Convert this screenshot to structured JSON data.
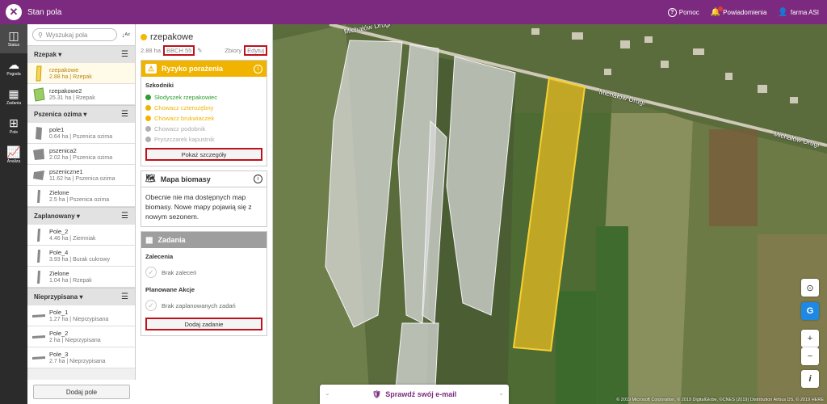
{
  "app": {
    "title": "Stan pola",
    "logo": "x-logo"
  },
  "topbar": {
    "help": "Pomoc",
    "notifications": "Powiadomienia",
    "user": "farma ASI"
  },
  "rail": [
    {
      "label": "Status",
      "icon": "status-icon"
    },
    {
      "label": "Pogoda",
      "icon": "weather-icon"
    },
    {
      "label": "Zadania",
      "icon": "tasks-icon"
    },
    {
      "label": "Pole",
      "icon": "field-icon"
    },
    {
      "label": "Analiza",
      "icon": "analysis-icon"
    }
  ],
  "search": {
    "placeholder": "Wyszukaj pola"
  },
  "groups": [
    {
      "name": "Rzepak",
      "fields": [
        {
          "name": "rzepakowe",
          "info": "2.88 ha | Rzepak"
        },
        {
          "name": "rzepakowe2",
          "info": "25.31 ha | Rzepak"
        }
      ]
    },
    {
      "name": "Pszenica ozima",
      "fields": [
        {
          "name": "pole1",
          "info": "0.64 ha | Pszenica ozima"
        },
        {
          "name": "pszenica2",
          "info": "2.02 ha | Pszenica ozima"
        },
        {
          "name": "pszeniczne1",
          "info": "11.62 ha | Pszenica ozima"
        },
        {
          "name": "Zielone",
          "info": "2.5 ha | Pszenica ozima"
        }
      ]
    },
    {
      "name": "Zaplanowany",
      "fields": [
        {
          "name": "Pole_2",
          "info": "4.46 ha | Ziemniak"
        },
        {
          "name": "Pole_4",
          "info": "3.93 ha | Burak cukrowy"
        },
        {
          "name": "Zielone",
          "info": "1.04 ha | Rzepak"
        }
      ]
    },
    {
      "name": "Nieprzypisana",
      "fields": [
        {
          "name": "Pole_1",
          "info": "1.27 ha | Nieprzypisana"
        },
        {
          "name": "Pole_2",
          "info": "2 ha | Nieprzypisana"
        },
        {
          "name": "Pole_3",
          "info": "2.7 ha | Nieprzypisana"
        }
      ]
    }
  ],
  "add_field": "Dodaj pole",
  "detail": {
    "name": "rzepakowe",
    "area": "2.88 ha",
    "bbch": "BBCH 55",
    "crops_link": "Zbiory",
    "edit_link": "Edytuj",
    "risk": {
      "title": "Ryzyko porażenia",
      "section": "Szkodniki",
      "pests": [
        {
          "name": "Słodyszek rzepakowiec",
          "color": "#2e9e2e"
        },
        {
          "name": "Chowacz czterozębny",
          "color": "#f0b400"
        },
        {
          "name": "Chowacz brukwiaczek",
          "color": "#f0b400"
        },
        {
          "name": "Chowacz podobnik",
          "color": "#b0b0b0"
        },
        {
          "name": "Pryszczarek kapustnik",
          "color": "#b0b0b0"
        }
      ],
      "button": "Pokaż szczegóły"
    },
    "biomass": {
      "title": "Mapa biomasy",
      "text": "Obecnie nie ma dostępnych map biomasy. Nowe mapy pojawią się z nowym sezonem."
    },
    "tasks": {
      "title": "Zadania",
      "rec_title": "Zalecenia",
      "rec_empty": "Brak zaleceń",
      "plan_title": "Planowane Akcje",
      "plan_empty": "Brak zaplanowanych zadań",
      "button": "Dodaj zadanie"
    }
  },
  "map": {
    "labels": [
      "Michałów Drugi",
      "Michałów Drugi",
      "Michałów Drugi"
    ],
    "email_cta": "Sprawdź swój e-mail",
    "credits": "© 2019 Microsoft Corporation, © 2019 DigitalGlobe, ©CNES (2019) Distribution Airbus DS, © 2019 HERE",
    "controls": [
      "locate-icon",
      "google-icon",
      "zoom-in-icon",
      "zoom-out-icon",
      "info-icon"
    ],
    "control_labels": {
      "google": "G",
      "zoom_in": "+",
      "zoom_out": "−",
      "info": "i"
    }
  },
  "colors": {
    "brand": "#7c2a7f",
    "accent": "#f0b400",
    "highlight": "#c0101b"
  }
}
